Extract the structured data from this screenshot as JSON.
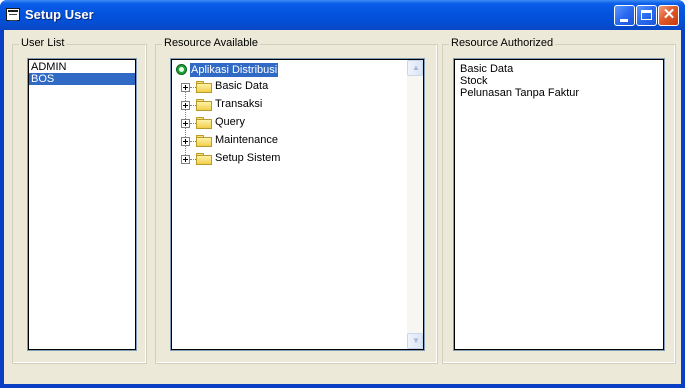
{
  "window": {
    "title": "Setup User",
    "close_glyph": "✕"
  },
  "user_list": {
    "title": "User List",
    "items": [
      "ADMIN",
      "BOS"
    ],
    "selected": "BOS"
  },
  "resource_available": {
    "title": "Resource Available",
    "root": "Aplikasi Distribusi",
    "nodes": [
      "Basic Data",
      "Transaksi",
      "Query",
      "Maintenance",
      "Setup Sistem"
    ]
  },
  "resource_authorized": {
    "title": "Resource Authorized",
    "items": [
      "Basic Data",
      "Stock",
      "Pelunasan Tanpa Faktur"
    ]
  },
  "scrollbar": {
    "up_glyph": "▲",
    "down_glyph": "▼"
  },
  "colors": {
    "title_bar": "#0454e0",
    "selection": "#316ac5",
    "dialog_face": "#ece9d8"
  }
}
